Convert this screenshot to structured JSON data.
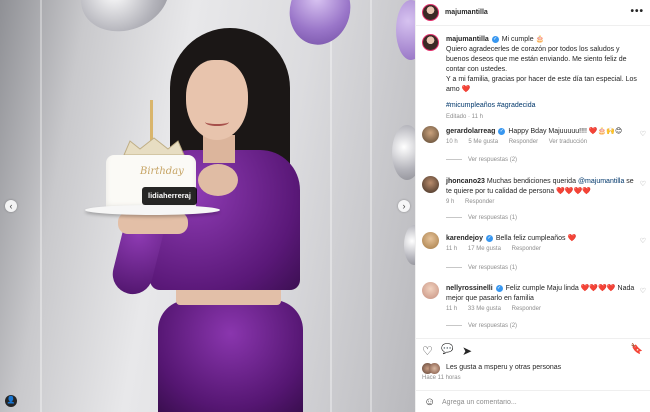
{
  "post": {
    "username": "majumantilla",
    "photo_tag": "lidiaherreraj",
    "cake_text": "Birthday",
    "caption": {
      "title": "Mi cumple 🎂",
      "line1": "Quiero agradecerles de corazón por todos los saludos y buenos deseos que me están enviando. Me siento feliz de contar con ustedes.",
      "line2": "Y a mi familia, gracias por hacer de este día tan especial. Los amo ❤️",
      "hashtags": "#micumpleaños #agradecida",
      "edited": "Editado · 11 h"
    }
  },
  "comments": [
    {
      "user": "gerardolarreag",
      "verified": true,
      "text": "Happy Bday Majuuuuu!!!! ❤️🎂🙌😊",
      "time": "10 h",
      "likes": "5 Me gusta",
      "reply": "Responder",
      "translate": "Ver traducción",
      "view_replies": "Ver respuestas (2)"
    },
    {
      "user": "jhoncano23",
      "verified": false,
      "text_pre": "Muchas bendiciones querida",
      "mention": "@majumantilla",
      "text_post": "se te quiere por tu calidad de persona",
      "hearts": "❤️❤️❤️❤️",
      "time": "9 h",
      "reply": "Responder",
      "view_replies": "Ver respuestas (1)"
    },
    {
      "user": "karendejoy",
      "verified": true,
      "text": "Bella feliz cumpleaños",
      "hearts": "❤️",
      "time": "11 h",
      "likes": "17 Me gusta",
      "reply": "Responder",
      "view_replies": "Ver respuestas (1)"
    },
    {
      "user": "nellyrossinelli",
      "verified": true,
      "text_pre": "Feliz cumple Maju linda",
      "hearts": "❤️❤️❤️❤️",
      "text_post": "Nada mejor que pasarlo en familia",
      "time": "11 h",
      "likes": "33 Me gusta",
      "reply": "Responder",
      "view_replies": "Ver respuestas (2)"
    }
  ],
  "likes_text": "Les gusta a msperu y otras personas",
  "time_ago": "Hace 11 horas",
  "add_comment": {
    "placeholder": "Agrega un comentario..."
  },
  "icons": {
    "heart": "♡",
    "comment": "💬",
    "share": "➤",
    "bookmark": "🔖",
    "more": "•••",
    "prev": "‹",
    "next": "›",
    "emoji": "☺",
    "user_tag": "👤",
    "small_heart": "♡"
  },
  "colors": {
    "link": "#00376b",
    "muted": "#8e8e8e",
    "verified": "#3897f0",
    "dress": "#6b1f8d"
  }
}
